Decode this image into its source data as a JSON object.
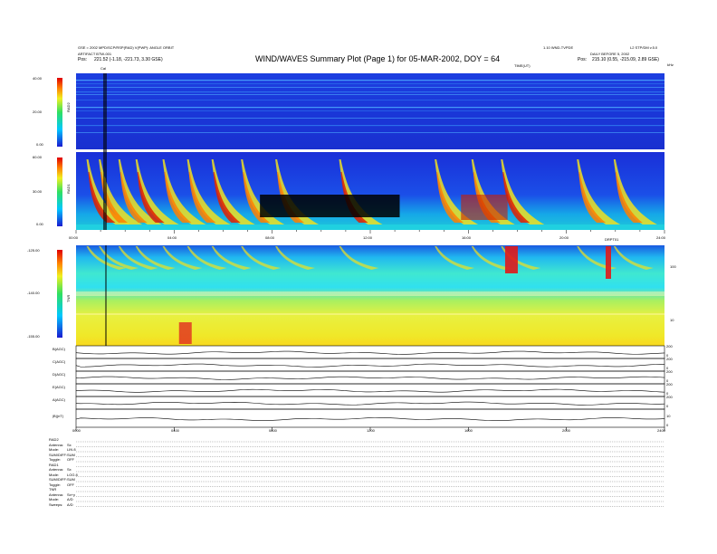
{
  "header": {
    "title": "WIND/WAVES Summary Plot (Page 1) for 05-MAR-2002, DOY = 64",
    "left_line1": "GSE = 2002 MPD/SCP/RSP(RAD) V(PWP): ANGLE ORBIT",
    "left_line2": "ARTIFACT BTW-001",
    "left_pos_label": "Pos:",
    "left_pos_value": "221.52 (-1.18, -221.73, 3.30 GSE)",
    "center_label": "TIME(UT)",
    "right_line1": "1.10 WND-TVPDE",
    "right_line1b": "L2 STP/DM v.5.0",
    "right_line2": "DAILY BEFORE 5, 2002",
    "right_pos_label": "Pos:",
    "right_pos_value": "215.10 (0.55, -215.09, 2.89 GSE)",
    "unit_right": "kHz",
    "cal_label": "Cal"
  },
  "panels": {
    "rad2": {
      "name": "RAD2",
      "ticks": [
        "40.00",
        "20.00",
        "0.00"
      ]
    },
    "rad1": {
      "name": "RAD1",
      "ticks": [
        "60.00",
        "30.00",
        "0.00"
      ]
    },
    "tnr": {
      "name": "TNR",
      "ticks": [
        "-125.00",
        "-140.00",
        "-155.00"
      ],
      "right_ticks": [
        "100",
        "10"
      ]
    },
    "mid_axis": {
      "ticks": [
        "00:00",
        "04:00",
        "08:00",
        "12:00",
        "16:00",
        "20:00",
        "24:00"
      ],
      "marker": "DRPT01"
    }
  },
  "lines": {
    "labels": [
      "B(AGC)",
      "C(AGC)",
      "D(AGC)",
      "E(AGC)",
      "A(AGC)",
      "|B|(nT)"
    ],
    "right_ticks": [
      [
        "0",
        "200"
      ],
      [
        "0",
        "200"
      ],
      [
        "0",
        "200"
      ],
      [
        "0",
        "200"
      ],
      [
        "0",
        "200"
      ],
      [
        "0",
        "10"
      ]
    ],
    "bottom_ticks": [
      "0000",
      "0400",
      "0800",
      "1200",
      "1600",
      "2000",
      "2400"
    ]
  },
  "footer": {
    "rows": [
      {
        "k": "RAD2",
        "v": ""
      },
      {
        "k": "Antenna:",
        "v": "Sx"
      },
      {
        "k": "Mode:",
        "v": "LIN 8"
      },
      {
        "k": "SUM/DIFF:",
        "v": "SUM"
      },
      {
        "k": "Toggle:",
        "v": "OFF"
      },
      {
        "k": "RAD1",
        "v": ""
      },
      {
        "k": "Antenna:",
        "v": "Sx"
      },
      {
        "k": "Mode:",
        "v": "LOG 8"
      },
      {
        "k": "SUM/DIFF:",
        "v": "SUM"
      },
      {
        "k": "Toggle:",
        "v": "OFF"
      },
      {
        "k": "TNR",
        "v": ""
      },
      {
        "k": "Antenna:",
        "v": "Sx+y"
      },
      {
        "k": "Mode:",
        "v": "A/D"
      },
      {
        "k": "Sweeps:",
        "v": "A/D"
      }
    ]
  },
  "colors": {
    "spec_low": "#1a2fd8",
    "spec_high": "#d01010"
  },
  "chart_data": [
    {
      "type": "heatmap",
      "name": "RAD2",
      "x": [
        0,
        24
      ],
      "xlabel": "TIME(UT)",
      "ylim": [
        0,
        40
      ],
      "ticks": [
        "40.00",
        "20.00",
        "0.00"
      ]
    },
    {
      "type": "heatmap",
      "name": "RAD1",
      "x": [
        0,
        24
      ],
      "ylim": [
        0,
        60
      ],
      "ticks": [
        "60.00",
        "30.00",
        "0.00"
      ],
      "burst_times_h": [
        0.5,
        1.0,
        1.8,
        2.5,
        3.6,
        4.6,
        5.6,
        6.8,
        8.2,
        10.8,
        14.7,
        16.2,
        17.4,
        20.5,
        22.0
      ]
    },
    {
      "type": "heatmap",
      "name": "TNR",
      "x": [
        0,
        24
      ],
      "ylim": [
        -155,
        -125
      ],
      "ticks": [
        "-125.00",
        "-140.00",
        "-155.00"
      ]
    },
    {
      "type": "line",
      "series": [
        {
          "name": "B(AGC)"
        },
        {
          "name": "C(AGC)"
        },
        {
          "name": "D(AGC)"
        },
        {
          "name": "E(AGC)"
        },
        {
          "name": "A(AGC)"
        },
        {
          "name": "|B|(nT)"
        }
      ],
      "x": [
        0,
        24
      ]
    }
  ]
}
